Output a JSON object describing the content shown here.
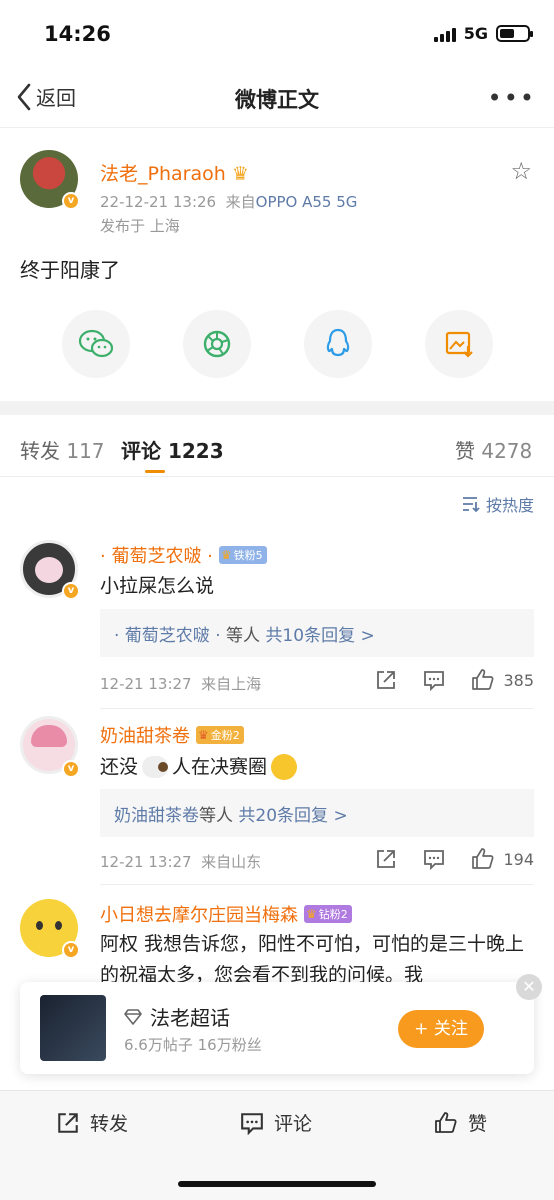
{
  "status_bar": {
    "time": "14:26",
    "network": "5G"
  },
  "nav": {
    "back_label": "返回",
    "title": "微博正文",
    "more": "•••"
  },
  "post": {
    "author": "法老_Pharaoh",
    "timestamp": "22-12-21 13:26",
    "source_prefix": "来自",
    "source": "OPPO A55 5G",
    "location": "发布于 上海",
    "text": "终于阳康了"
  },
  "share_targets": [
    "wechat-icon",
    "moments-icon",
    "qq-icon",
    "save-image-icon"
  ],
  "tabs": [
    {
      "label": "转发",
      "count": "117"
    },
    {
      "label": "评论",
      "count": "1223"
    },
    {
      "label": "赞",
      "count": "4278"
    }
  ],
  "sort_label": "按热度",
  "comments": [
    {
      "name": "· 葡萄芝农啵 ·",
      "badge": "铁粉5",
      "text": "小拉屎怎么说",
      "reply_name": "· 葡萄芝农啵 ·",
      "reply_mid": " 等人 ",
      "reply_count": "共10条回复 >",
      "time": "12-21 13:27",
      "from": "来自上海",
      "likes": "385"
    },
    {
      "name": "奶油甜茶卷",
      "badge": "金粉2",
      "text_a": "还没",
      "text_b": "人在决赛圈",
      "reply_name": "奶油甜茶卷",
      "reply_mid": "等人 ",
      "reply_count": "共20条回复 >",
      "time": "12-21 13:27",
      "from": "来自山东",
      "likes": "194"
    },
    {
      "name": "小日想去摩尔庄园当梅森",
      "badge": "钻粉2",
      "text": "阿权 我想告诉您，阳性不可怕，可怕的是三十晚上的祝福太多，您会看不到我的问候。我"
    }
  ],
  "floater": {
    "title": "法老超话",
    "subtitle": "6.6万帖子 16万粉丝",
    "follow_label": "+ 关注"
  },
  "bottom_bar": {
    "repost": "转发",
    "comment": "评论",
    "like": "赞"
  },
  "colors": {
    "accent": "#f0700e",
    "link": "#5e7ba8",
    "follow": "#f79a1e"
  }
}
